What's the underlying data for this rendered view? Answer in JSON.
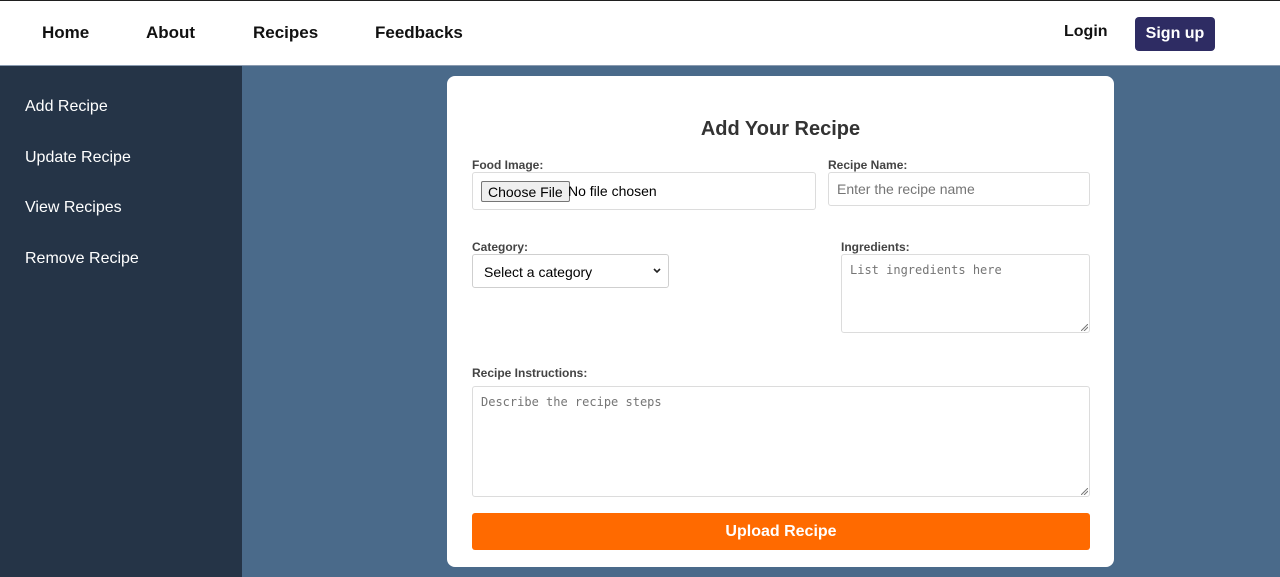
{
  "nav": {
    "items": [
      "Home",
      "About",
      "Recipes",
      "Feedbacks"
    ],
    "login": "Login",
    "signup": "Sign up"
  },
  "sidebar": {
    "items": [
      "Add Recipe",
      "Update Recipe",
      "View Recipes",
      "Remove Recipe"
    ]
  },
  "form": {
    "title": "Add Your Recipe",
    "food_image_label": "Food Image:",
    "choose_file": "Choose File",
    "file_status": "No file chosen",
    "recipe_name_label": "Recipe Name:",
    "recipe_name_placeholder": "Enter the recipe name",
    "category_label": "Category:",
    "category_selected": "Select a category",
    "ingredients_label": "Ingredients:",
    "ingredients_placeholder": "List ingredients here",
    "instructions_label": "Recipe Instructions:",
    "instructions_placeholder": "Describe the recipe steps",
    "upload_button": "Upload Recipe"
  },
  "colors": {
    "sidebar_bg": "#253447",
    "content_bg": "#4a6a8a",
    "signup_bg": "#2e2c63",
    "upload_bg": "#ff6a00"
  },
  "icons": {
    "select": "chevron-down-icon",
    "resize": "resize-grip-icon"
  }
}
